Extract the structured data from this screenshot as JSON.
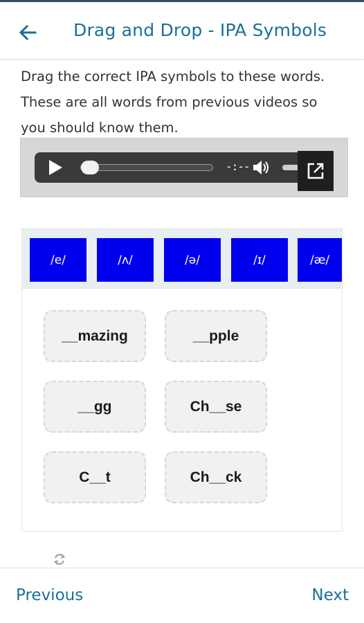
{
  "header": {
    "title": "Drag and Drop - IPA Symbols",
    "back_icon": "arrow-left-icon",
    "accent_color": "#1a6f98"
  },
  "instructions": {
    "text": "Drag the correct IPA symbols to these words. These are all words from previous videos so you should know them."
  },
  "audio_player": {
    "time_display": "-:--",
    "progress": 0,
    "icons": [
      "play-icon",
      "volume-icon",
      "popout-icon"
    ]
  },
  "symbols": [
    "/e/",
    "/ʌ/",
    "/ə/",
    "/ɪ/",
    "/æ/"
  ],
  "symbol_color": "#0000ee",
  "words": [
    "__mazing",
    "__pple",
    "__gg",
    "Ch__se",
    "C__t",
    "Ch__ck"
  ],
  "footer": {
    "previous_label": "Previous",
    "next_label": "Next"
  }
}
